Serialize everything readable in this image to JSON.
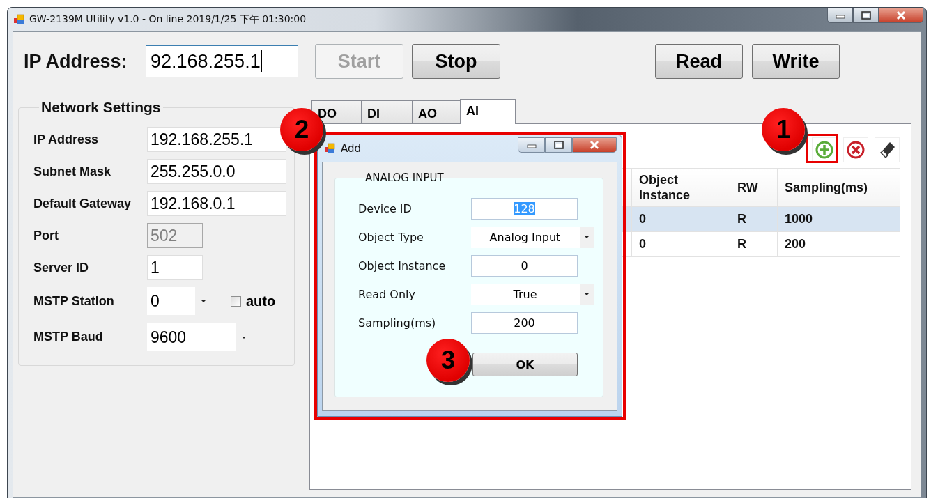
{
  "window": {
    "title": "GW-2139M Utility v1.0 - On line 2019/1/25 下午 01:30:00"
  },
  "toolbar": {
    "ip_label": "IP Address:",
    "ip_value": "92.168.255.1",
    "buttons": [
      {
        "label": "Start",
        "disabled": true
      },
      {
        "label": "Stop",
        "disabled": false
      },
      {
        "label": "Read",
        "disabled": false
      },
      {
        "label": "Write",
        "disabled": false
      }
    ]
  },
  "network_settings": {
    "title": "Network Settings",
    "fields": [
      {
        "label": "IP Address",
        "value": "192.168.255.1",
        "kind": "text",
        "disabled": false
      },
      {
        "label": "Subnet Mask",
        "value": "255.255.0.0",
        "kind": "text",
        "disabled": false
      },
      {
        "label": "Default Gateway",
        "value": "192.168.0.1",
        "kind": "text",
        "disabled": false
      },
      {
        "label": "Port",
        "value": "502",
        "kind": "short",
        "disabled": true
      },
      {
        "label": "Server ID",
        "value": "1",
        "kind": "short",
        "disabled": false
      },
      {
        "label": "MSTP Station",
        "value": "0",
        "kind": "combo-check",
        "disabled": false,
        "checkbox": {
          "label": "auto",
          "checked": false
        }
      },
      {
        "label": "MSTP Baud",
        "value": "9600",
        "kind": "combo",
        "disabled": false
      }
    ]
  },
  "tabs": [
    {
      "label": "DO",
      "selected": false
    },
    {
      "label": "DI",
      "selected": false
    },
    {
      "label": "AO",
      "selected": false
    },
    {
      "label": "AI",
      "selected": true
    }
  ],
  "table": {
    "columns": [
      "Object\nInstance",
      "RW",
      "Sampling(ms)"
    ],
    "rows": [
      {
        "selected": true,
        "cells": [
          "0",
          "R",
          "1000"
        ]
      },
      {
        "selected": false,
        "cells": [
          "0",
          "R",
          "200"
        ]
      }
    ]
  },
  "dialog": {
    "title": "Add",
    "group": "ANALOG INPUT",
    "fields": [
      {
        "label": "Device ID",
        "value": "128",
        "kind": "text",
        "highlighted": true
      },
      {
        "label": "Object Type",
        "value": "Analog Input",
        "kind": "combo",
        "highlighted": false
      },
      {
        "label": "Object Instance",
        "value": "0",
        "kind": "text",
        "highlighted": false
      },
      {
        "label": "Read Only",
        "value": "True",
        "kind": "combo",
        "highlighted": false
      },
      {
        "label": "Sampling(ms)",
        "value": "200",
        "kind": "text",
        "highlighted": false
      }
    ],
    "ok": "OK"
  },
  "callouts": [
    {
      "label": "1"
    },
    {
      "label": "2"
    },
    {
      "label": "3"
    }
  ]
}
